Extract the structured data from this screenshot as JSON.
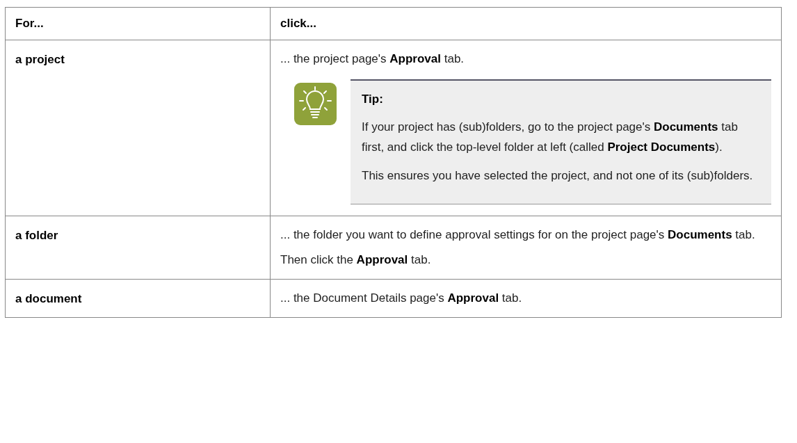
{
  "table": {
    "columns": [
      "For...",
      "click..."
    ],
    "rows": [
      {
        "for": "a project",
        "click": [
          "... the project page's **Approval** tab."
        ],
        "tip": {
          "title": "Tip:",
          "paragraphs": [
            "If your project has (sub)folders, go to the project page's **Documents** tab first, and click the top-level folder at left (called **Project Documents**).",
            "This ensures you have selected the project, and not one of its (sub)folders."
          ]
        }
      },
      {
        "for": "a folder",
        "click": [
          "... the folder you want to define approval settings for on the project page's **Documents** tab.",
          "Then click the **Approval** tab."
        ]
      },
      {
        "for": "a document",
        "click": [
          "... the Document Details page's **Approval** tab."
        ]
      }
    ]
  }
}
